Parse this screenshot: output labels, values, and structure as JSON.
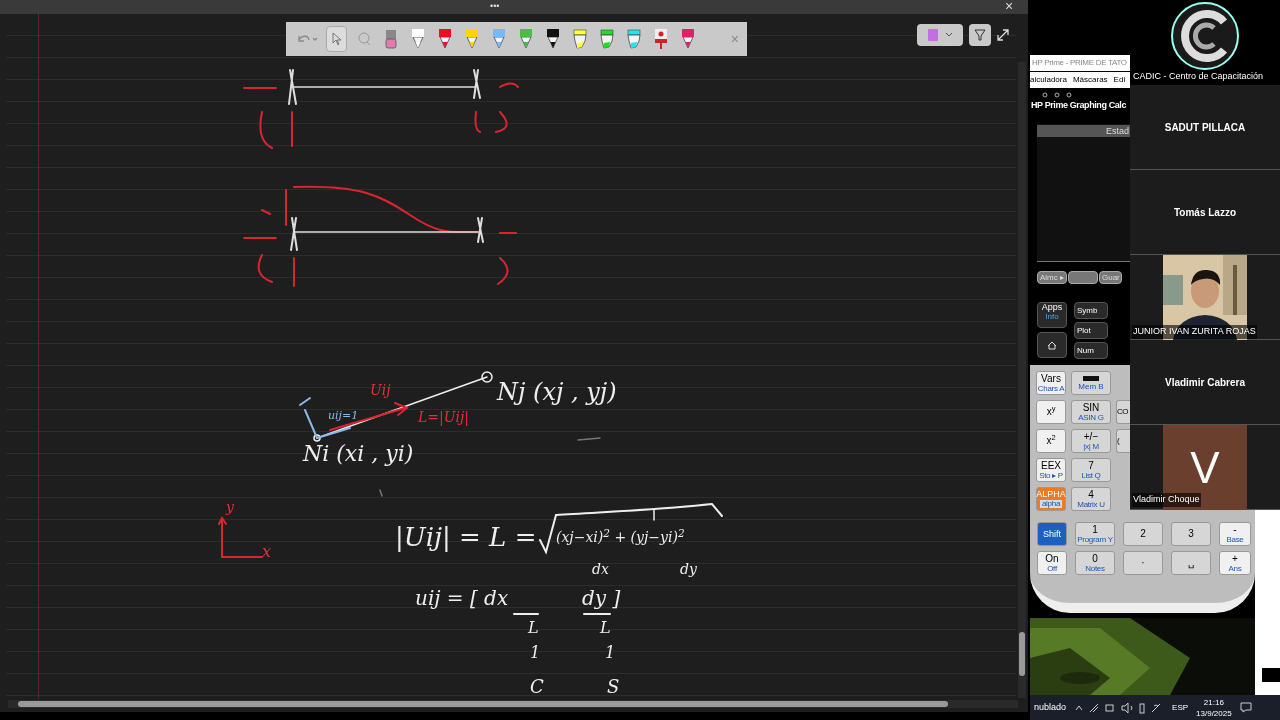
{
  "whiteboard": {
    "toolbar": {
      "tools": [
        {
          "kind": "undo",
          "selected": false
        },
        {
          "kind": "select",
          "selected": true
        },
        {
          "kind": "lasso",
          "selected": false
        },
        {
          "kind": "eraser",
          "selected": false
        },
        {
          "kind": "pen",
          "color": "#ffffff",
          "selected": false
        },
        {
          "kind": "pen",
          "color": "#e81123",
          "selected": false
        },
        {
          "kind": "pen",
          "color": "#ffd400",
          "selected": false
        },
        {
          "kind": "pen",
          "color": "#7ab8f5",
          "selected": false
        },
        {
          "kind": "pen",
          "color": "#4cbb4c",
          "selected": false
        },
        {
          "kind": "pen",
          "color": "#111111",
          "selected": false
        },
        {
          "kind": "highlighter",
          "color": "#ffff33",
          "selected": false
        },
        {
          "kind": "highlighter",
          "color": "#22dd22",
          "selected": false
        },
        {
          "kind": "highlighter",
          "color": "#22e5f0",
          "selected": false
        },
        {
          "kind": "laser",
          "color": "#d0202a",
          "selected": false
        },
        {
          "kind": "pen",
          "color": "#e0206a",
          "selected": false
        }
      ]
    },
    "menu_dots": "•••",
    "close": "×",
    "ink_texts": [
      {
        "text": "Uij",
        "color": "#e0303a"
      },
      {
        "text": "L=|Uij|",
        "color": "#e0303a"
      },
      {
        "text": "uij=1",
        "color": "#8ab8e8"
      },
      {
        "text": "Nj (xj , yj)",
        "color": "#eeeeee"
      },
      {
        "text": "Ni (xi , yi)",
        "color": "#eeeeee"
      },
      {
        "text": "|Uij| = L =",
        "color": "#eeeeee"
      },
      {
        "text": "(xj−xi)$^{2}$ + (yj−yi)$^{2}$",
        "color": "#eeeeee"
      },
      {
        "text": "dx",
        "color": "#eeeeee"
      },
      {
        "text": "dy",
        "color": "#eeeeee"
      },
      {
        "text": "uij = [ dx",
        "color": "#eeeeee"
      },
      {
        "text": "dy ]",
        "color": "#eeeeee"
      },
      {
        "text": "L",
        "color": "#eeeeee"
      },
      {
        "text": "L",
        "color": "#eeeeee"
      },
      {
        "text": "1",
        "color": "#eeeeee"
      },
      {
        "text": "1",
        "color": "#eeeeee"
      },
      {
        "text": "C",
        "color": "#eeeeee"
      },
      {
        "text": "S",
        "color": "#eeeeee"
      },
      {
        "text": "y",
        "color": "#e0303a"
      },
      {
        "text": "x",
        "color": "#e0303a"
      }
    ]
  },
  "notebook_button": {
    "color": "#c070e0"
  },
  "calculator": {
    "window_title": "HP Prime - PRIME DE TATO",
    "menu": [
      "alculadora",
      "Máscaras",
      "Edi"
    ],
    "model": "HP Prime Graphing Calc",
    "screen_header": "Estad",
    "softkeys": [
      "Almc ▸",
      "Guar"
    ],
    "top_keys": [
      {
        "label": "Apps",
        "sub": "Info"
      },
      {
        "label": "Symb"
      },
      {
        "label": "Plot"
      },
      {
        "label": "Num"
      }
    ],
    "key_rows": [
      [
        {
          "label": "Vars",
          "sub": "Chars A",
          "kind": "light"
        },
        {
          "label": "Mem B",
          "kind": "mem"
        }
      ],
      [
        {
          "label": "x$^{y}$",
          "kind": "light"
        },
        {
          "label": "SIN",
          "sub": "ASIN G",
          "kind": "gray"
        },
        {
          "label": "CO",
          "kind": "gray"
        }
      ],
      [
        {
          "label": "x$^{2}$",
          "kind": "light"
        },
        {
          "label": "+/−",
          "sub": "|x| M",
          "kind": "gray"
        },
        {
          "label": "(",
          "kind": "gray"
        }
      ],
      [
        {
          "label": "EEX",
          "sub": "Sto ▸ P",
          "kind": "light"
        },
        {
          "label": "7",
          "sub": "List Q",
          "kind": "gray"
        }
      ],
      [
        {
          "label": "ALPHA",
          "sub": "alpha",
          "kind": "alpha"
        },
        {
          "label": "4",
          "sub": "Matrix U",
          "kind": "gray"
        }
      ],
      [
        {
          "label": "Shift",
          "kind": "shift"
        },
        {
          "label": "1",
          "sub": "Program Y",
          "kind": "gray"
        },
        {
          "label": "2",
          "kind": "gray"
        },
        {
          "label": "3",
          "kind": "gray"
        },
        {
          "label": "-",
          "sub": "Base",
          "kind": "light"
        }
      ],
      [
        {
          "label": "On",
          "sub": "Off",
          "kind": "light"
        },
        {
          "label": "0",
          "sub": "Notes",
          "kind": "gray"
        },
        {
          "label": "·",
          "kind": "gray"
        },
        {
          "label": "␣",
          "kind": "gray"
        },
        {
          "label": "+",
          "sub": "Ans",
          "kind": "light"
        }
      ]
    ]
  },
  "participants": [
    {
      "kind": "logo",
      "name": "CADIC - Centro de Capacitación"
    },
    {
      "kind": "name",
      "name": "SADUT PILLACA"
    },
    {
      "kind": "name",
      "name": "Tomás Lazzo"
    },
    {
      "kind": "video",
      "name": "JUNIOR IVAN ZURITA ROJAS"
    },
    {
      "kind": "name",
      "name": "Vladimir Cabrera"
    },
    {
      "kind": "avatar",
      "name": "Vladimir Choque",
      "initial": "V",
      "color": "#6b3f2e"
    }
  ],
  "taskbar": {
    "weather": "nublado",
    "language": "ESP",
    "time": "21:16",
    "date": "13/9/2025"
  }
}
